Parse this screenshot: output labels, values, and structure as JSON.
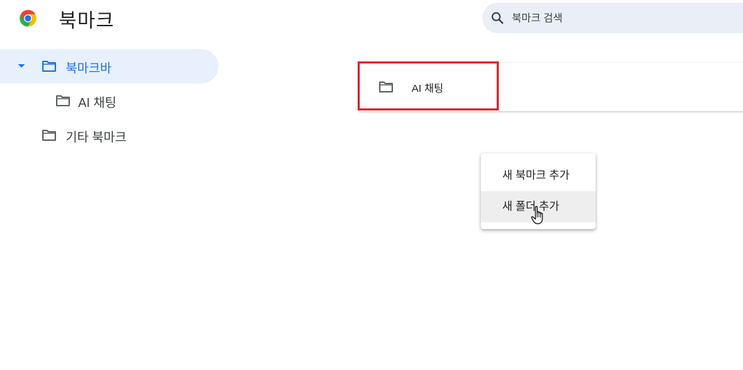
{
  "header": {
    "title": "북마크",
    "search_placeholder": "북마크 검색"
  },
  "sidebar": {
    "items": [
      {
        "label": "북마크바",
        "selected": true,
        "expanded": true
      },
      {
        "label": "AI 채팅"
      },
      {
        "label": "기타 북마크"
      }
    ]
  },
  "main": {
    "list": [
      {
        "label": "AI 채팅"
      }
    ]
  },
  "context_menu": {
    "items": [
      {
        "label": "새 북마크 추가"
      },
      {
        "label": "새 폴더 추가",
        "hovered": true
      }
    ]
  },
  "colors": {
    "accent": "#1a73e8",
    "selected_bg": "#e8f0fe",
    "search_bg": "#eaeef6",
    "highlight_border": "#e0202a"
  }
}
